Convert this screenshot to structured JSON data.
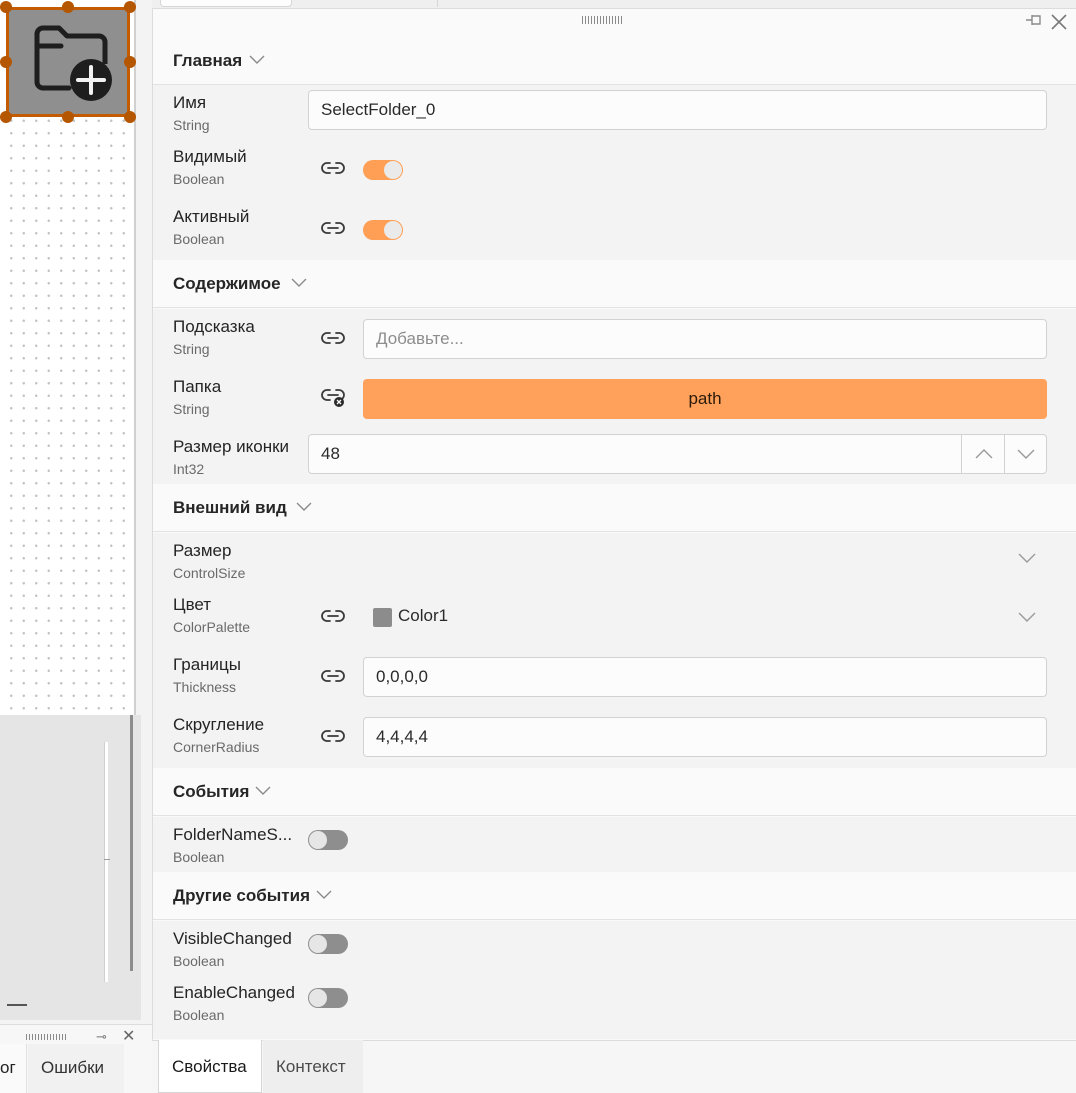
{
  "designer": {
    "selected_control": "folder-plus-icon",
    "bottom_tabs": [
      {
        "label": "ог"
      },
      {
        "label": "Ошибки"
      }
    ]
  },
  "properties": {
    "sections": {
      "main": {
        "title": "Главная",
        "name": {
          "label": "Имя",
          "type": "String",
          "value": "SelectFolder_0"
        },
        "visible": {
          "label": "Видимый",
          "type": "Boolean",
          "checked": true
        },
        "enabled": {
          "label": "Активный",
          "type": "Boolean",
          "checked": true
        }
      },
      "content": {
        "title": "Содержимое",
        "hint": {
          "label": "Подсказка",
          "type": "String",
          "placeholder": "Добавьте..."
        },
        "folder": {
          "label": "Папка",
          "type": "String",
          "button_label": "path"
        },
        "icon_size": {
          "label": "Размер иконки",
          "type": "Int32",
          "value": "48"
        }
      },
      "appearance": {
        "title": "Внешний вид",
        "size": {
          "label": "Размер",
          "type": "ControlSize",
          "value": ""
        },
        "color": {
          "label": "Цвет",
          "type": "ColorPalette",
          "value": "Color1",
          "swatch": "#8c8c8c"
        },
        "borders": {
          "label": "Границы",
          "type": "Thickness",
          "value": "0,0,0,0"
        },
        "corner": {
          "label": "Скругление",
          "type": "CornerRadius",
          "value": "4,4,4,4"
        }
      },
      "events": {
        "title": "События",
        "folder_name_selected": {
          "label": "FolderNameS...",
          "type": "Boolean",
          "checked": false
        }
      },
      "other_events": {
        "title": "Другие события",
        "visible_changed": {
          "label": "VisibleChanged",
          "type": "Boolean",
          "checked": false
        },
        "enable_changed": {
          "label": "EnableChanged",
          "type": "Boolean",
          "checked": false
        }
      }
    },
    "tabs": [
      {
        "label": "Свойства",
        "active": true
      },
      {
        "label": "Контекст",
        "active": false
      }
    ]
  },
  "colors": {
    "accent": "#ff9f55",
    "selection_border": "#c35b00"
  }
}
